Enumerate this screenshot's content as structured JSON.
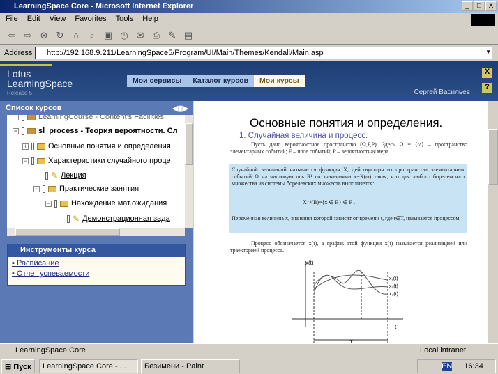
{
  "window": {
    "title": "LearningSpace Core - Microsoft Internet Explorer",
    "min": "_",
    "max": "□",
    "close": "X"
  },
  "menu": [
    "File",
    "Edit",
    "View",
    "Favorites",
    "Tools",
    "Help"
  ],
  "address": {
    "label": "Address",
    "url": "http://192.168.9.211/LearningSpace5/Program/UI/Main/Themes/Kendall/Main.asp"
  },
  "ls": {
    "logo1": "Lotus",
    "logo2": "LearningSpace",
    "release": "Release 5",
    "nav": [
      "Мои сервисы",
      "Каталог курсов",
      "Мои курсы"
    ],
    "user": "Сергей Васильев",
    "close": "X",
    "help": "?"
  },
  "courses": {
    "title": "Список курсов",
    "items": [
      "LearningCourse - Content's Facilities",
      "sl_process - Теория вероятности. Сл",
      "Основные понятия и определения",
      "Характеристики случайного проце",
      "Лекция",
      "Практические занятия",
      "Нахождение мат.ожидания",
      "Демонстрационная зада"
    ]
  },
  "tools": {
    "title": "Инструменты курса",
    "links": [
      "Расписание",
      "Отчет успеваемости"
    ]
  },
  "doc": {
    "title": "Основные понятия и определения.",
    "subtitle": "1. Случайная величина и процесс.",
    "p1": "Пусть дано вероятностное пространство (Ω,F,P). Здесь Ω = {ω} – пространство элементарных событий; F – поле событий; P – вероятностная мера.",
    "def": "Случайной величиной называется функция X, действующая из пространства элементарных событий Ω на числовую ось R¹ со значениями x=X(ω) такая, что для любого борелевского множества из системы борелевских множеств выполняется:",
    "formula": "X⁻¹(B)={x ∈ B} ∈ F .",
    "p2": "Переменная величина x, значения которой зависят от времени t, где t∈T, называется процессом.",
    "p3": "Процесс обозначается x(t), а график этой функции x(t) называется реализацией или траекторией процесса.",
    "graph": {
      "ylabel": "x(t)",
      "xlabel": "t",
      "period": "T",
      "curves": [
        "x₁(t)",
        "x₂(t)",
        "x₃(t)"
      ]
    }
  },
  "status": {
    "text": "LearningSpace Core",
    "zone": "Local intranet"
  },
  "taskbar": {
    "start": "Пуск",
    "tasks": [
      "LearningSpace Core - ...",
      "Безимени - Paint"
    ],
    "lang": "EN",
    "clock": "16:34"
  }
}
